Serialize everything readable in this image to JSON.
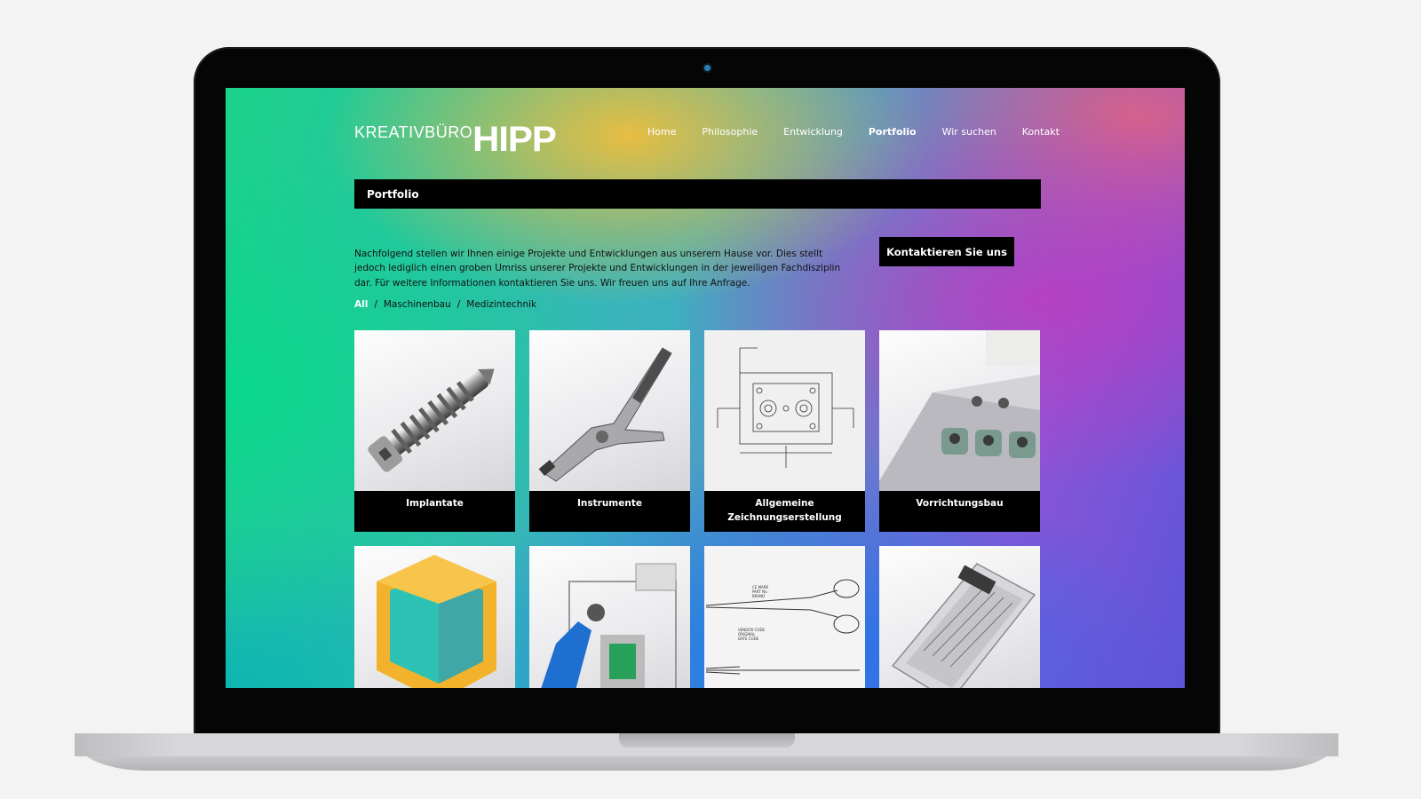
{
  "brand": {
    "light": "KREATIVBÜRO",
    "bold": "HIPP"
  },
  "nav": [
    {
      "label": "Home",
      "active": false
    },
    {
      "label": "Philosophie",
      "active": false
    },
    {
      "label": "Entwicklung",
      "active": false
    },
    {
      "label": "Portfolio",
      "active": true
    },
    {
      "label": "Wir suchen",
      "active": false
    },
    {
      "label": "Kontakt",
      "active": false
    }
  ],
  "page_title": "Portfolio",
  "intro": "Nachfolgend stellen wir Ihnen einige Projekte und Entwicklungen aus unserem Hause vor. Dies stellt jedoch lediglich einen groben Umriss unserer Projekte und Entwicklungen in der jeweiligen Fachdisziplin dar. Für weitere Informationen kontaktieren Sie uns. Wir freuen uns auf Ihre Anfrage.",
  "cta_label": "Kontaktieren Sie uns",
  "filters": [
    {
      "label": "All",
      "active": true
    },
    {
      "label": "Maschinenbau",
      "active": false
    },
    {
      "label": "Medizintechnik",
      "active": false
    }
  ],
  "filter_separator": "/",
  "portfolio": [
    {
      "caption": "Implantate",
      "icon": "screw-implant-image"
    },
    {
      "caption": "Instrumente",
      "icon": "pliers-instrument-image"
    },
    {
      "caption": "Allgemeine Zeichnungserstellung",
      "icon": "technical-drawing-image"
    },
    {
      "caption": "Vorrichtungsbau",
      "icon": "fixture-image"
    },
    {
      "caption": "",
      "icon": "yellow-housing-image"
    },
    {
      "caption": "",
      "icon": "machine-assembly-image"
    },
    {
      "caption": "",
      "icon": "scissors-drawing-image"
    },
    {
      "caption": "",
      "icon": "sterilization-tray-image"
    }
  ],
  "drawing_labels": {
    "scissors": [
      "CE MARK",
      "PART No.",
      "BRAND",
      "VENDOR CODE",
      "ORIGINAL",
      "DATE CODE"
    ]
  },
  "colors": {
    "accent_black": "#000000",
    "text_white": "#ffffff"
  }
}
